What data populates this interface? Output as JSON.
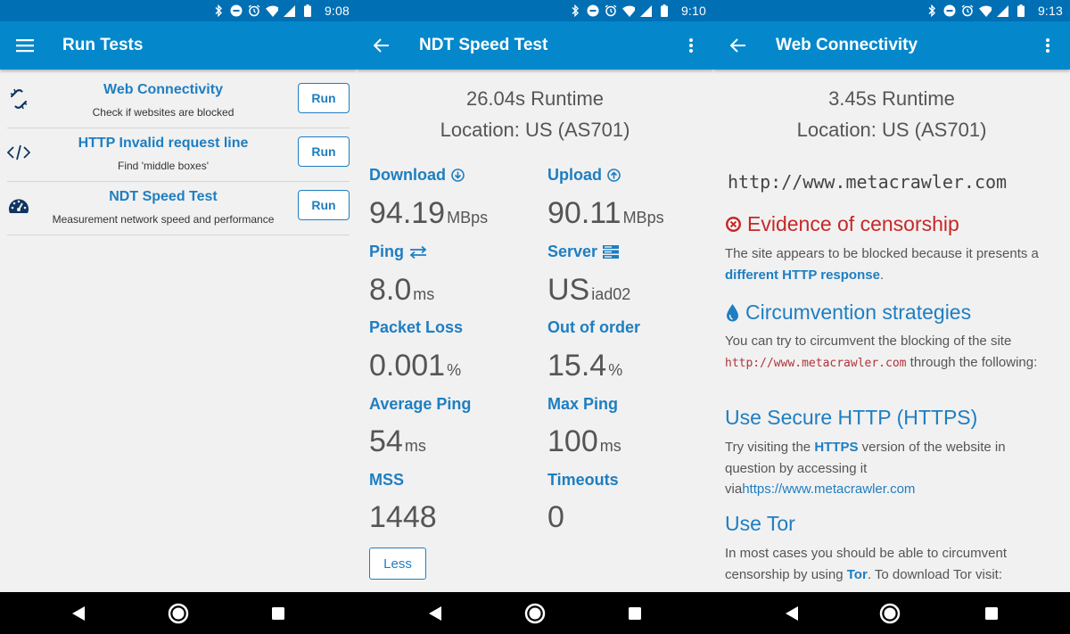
{
  "screens": [
    {
      "status_time": "9:08",
      "title": "Run Tests",
      "tests": [
        {
          "name": "Web Connectivity",
          "desc": "Check if websites are blocked",
          "run": "Run"
        },
        {
          "name": "HTTP Invalid request line",
          "desc": "Find 'middle boxes'",
          "run": "Run"
        },
        {
          "name": "NDT Speed Test",
          "desc": "Measurement network speed and performance",
          "run": "Run"
        }
      ]
    },
    {
      "status_time": "9:10",
      "title": "NDT Speed Test",
      "runtime": "26.04s Runtime",
      "location": "Location: US (AS701)",
      "metrics": {
        "download": {
          "label": "Download",
          "value": "94.19",
          "unit": "MBps"
        },
        "upload": {
          "label": "Upload",
          "value": "90.11",
          "unit": "MBps"
        },
        "ping": {
          "label": "Ping",
          "value": "8.0",
          "unit": "ms"
        },
        "server": {
          "label": "Server",
          "value": "US",
          "unit": "iad02"
        },
        "packet_loss": {
          "label": "Packet Loss",
          "value": "0.001",
          "unit": "%"
        },
        "out_of_order": {
          "label": "Out of order",
          "value": "15.4",
          "unit": "%"
        },
        "avg_ping": {
          "label": "Average Ping",
          "value": "54",
          "unit": "ms"
        },
        "max_ping": {
          "label": "Max Ping",
          "value": "100",
          "unit": "ms"
        },
        "mss": {
          "label": "MSS",
          "value": "1448",
          "unit": ""
        },
        "timeouts": {
          "label": "Timeouts",
          "value": "0",
          "unit": ""
        }
      },
      "less_label": "Less"
    },
    {
      "status_time": "9:13",
      "title": "Web Connectivity",
      "runtime": "3.45s Runtime",
      "location": "Location: US (AS701)",
      "url": "http://www.metacrawler.com",
      "evidence_heading": "Evidence of censorship",
      "evidence_text_1": "The site appears to be blocked because it presents a ",
      "evidence_link": "different HTTP response",
      "evidence_text_2": ".",
      "circ_heading": "Circumvention strategies",
      "circ_text_1": "You can try to circumvent the blocking of the site ",
      "circ_code": "http://www.metacrawler.com",
      "circ_text_2": " through the following:",
      "https_heading": "Use Secure HTTP (HTTPS)",
      "https_text_1": "Try visiting the ",
      "https_bold": "HTTPS",
      "https_text_2": " version of the website in question by accessing it via",
      "https_link": "https://www.metacrawler.com",
      "tor_heading": "Use Tor",
      "tor_text_1": "In most cases you should be able to circumvent censorship by using ",
      "tor_bold": "Tor",
      "tor_text_2": ". To download Tor visit:"
    }
  ],
  "icons": {
    "status": [
      "bluetooth-icon",
      "do-not-disturb-icon",
      "alarm-icon",
      "wifi-icon",
      "signal-icon",
      "battery-icon"
    ],
    "nav": [
      "back-nav-icon",
      "home-nav-icon",
      "recents-nav-icon"
    ]
  },
  "colors": {
    "status_bar": "#006fb4",
    "app_bar": "#0588cb",
    "accent": "#1e7ec1",
    "censorship_red": "#c62828"
  }
}
